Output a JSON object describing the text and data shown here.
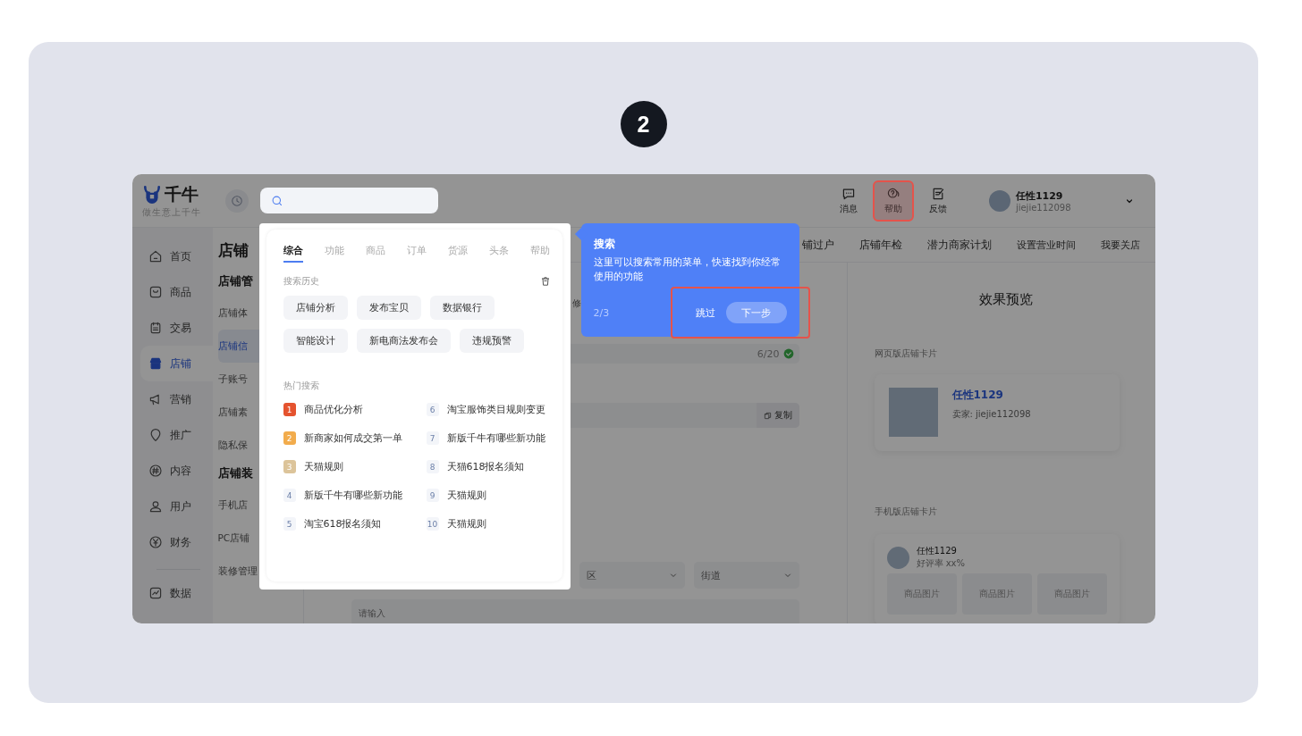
{
  "step_badge": "2",
  "app": {
    "logo": {
      "name": "千牛",
      "slogan": "做生意上千牛"
    },
    "header_actions": [
      {
        "label": "消息",
        "kind": "message",
        "highlighted": false
      },
      {
        "label": "帮助",
        "kind": "help",
        "highlighted": true
      },
      {
        "label": "反馈",
        "kind": "feedback",
        "highlighted": false
      }
    ],
    "user": {
      "name": "任性1129",
      "account": "jiejie112098"
    },
    "sidebar": {
      "items": [
        {
          "label": "首页",
          "kind": "home",
          "selected": false
        },
        {
          "label": "商品",
          "kind": "goods",
          "selected": false
        },
        {
          "label": "交易",
          "kind": "trade",
          "selected": false
        },
        {
          "label": "店铺",
          "kind": "shop",
          "selected": true
        },
        {
          "label": "营销",
          "kind": "marketing",
          "selected": false
        },
        {
          "label": "推广",
          "kind": "promote",
          "selected": false
        },
        {
          "label": "内容",
          "kind": "content",
          "selected": false
        },
        {
          "label": "用户",
          "kind": "user",
          "selected": false
        },
        {
          "label": "财务",
          "kind": "finance",
          "selected": false
        },
        {
          "label": "数据",
          "kind": "data",
          "selected": false
        }
      ]
    },
    "subnav": {
      "title": "店铺",
      "groups": [
        {
          "title": "店铺管",
          "items": [
            {
              "label": "店铺体",
              "selected": false
            },
            {
              "label": "店铺信",
              "selected": true
            },
            {
              "label": "子账号",
              "selected": false
            },
            {
              "label": "店铺素",
              "selected": false
            },
            {
              "label": "隐私保",
              "selected": false
            }
          ]
        },
        {
          "title": "店铺装",
          "items": [
            {
              "label": "手机店",
              "selected": false
            },
            {
              "label": "PC店铺",
              "selected": false
            },
            {
              "label": "装修管理",
              "selected": false
            }
          ]
        }
      ]
    },
    "top_tabs": [
      "铺过户",
      "店铺年检",
      "潜力商家计划",
      "设置营业时间",
      "我要关店"
    ],
    "form": {
      "fragment": "修",
      "name_counter": "6/20",
      "copy_button": "复制",
      "selects": [
        {
          "placeholder": "区"
        },
        {
          "placeholder": "街道"
        }
      ],
      "address_placeholder": "请输入"
    },
    "preview": {
      "title": "效果预览",
      "web_card": {
        "label": "网页版店铺卡片",
        "shop_name": "任性1129",
        "seller": "卖家: jiejie112098"
      },
      "mobile_card": {
        "label": "手机版店铺卡片",
        "shop_name": "任性1129",
        "rating": "好评率 xx%",
        "images": [
          "商品图片",
          "商品图片",
          "商品图片"
        ]
      }
    }
  },
  "search_popup": {
    "tabs": [
      {
        "label": "综合",
        "selected": true
      },
      {
        "label": "功能",
        "selected": false
      },
      {
        "label": "商品",
        "selected": false
      },
      {
        "label": "订单",
        "selected": false
      },
      {
        "label": "货源",
        "selected": false
      },
      {
        "label": "头条",
        "selected": false
      },
      {
        "label": "帮助",
        "selected": false
      }
    ],
    "history_title": "搜索历史",
    "history": [
      "店铺分析",
      "发布宝贝",
      "数据银行",
      "智能设计",
      "新电商法发布会",
      "违规预警"
    ],
    "hot_title": "热门搜索",
    "hot": [
      {
        "rank": "1",
        "label": "商品优化分析",
        "color": "#e5532f"
      },
      {
        "rank": "2",
        "label": "新商家如何成交第一单",
        "color": "#f2ac4c"
      },
      {
        "rank": "3",
        "label": "天猫规则",
        "color": "#dcc49a"
      },
      {
        "rank": "4",
        "label": "新版千牛有哪些新功能",
        "color": "#f3f5f9"
      },
      {
        "rank": "5",
        "label": "淘宝618报名须知",
        "color": "#f3f5f9"
      },
      {
        "rank": "6",
        "label": "淘宝服饰类目规则变更",
        "color": "#f3f5f9"
      },
      {
        "rank": "7",
        "label": "新版千牛有哪些新功能",
        "color": "#f3f5f9"
      },
      {
        "rank": "8",
        "label": "天猫618报名须知",
        "color": "#f3f5f9"
      },
      {
        "rank": "9",
        "label": "天猫规则",
        "color": "#f3f5f9"
      },
      {
        "rank": "10",
        "label": "天猫规则",
        "color": "#f3f5f9"
      }
    ]
  },
  "guide_tooltip": {
    "title": "搜索",
    "text": "这里可以搜索常用的菜单，快速找到你经常使用的功能",
    "progress": "2/3",
    "skip": "跳过",
    "next": "下一步"
  }
}
